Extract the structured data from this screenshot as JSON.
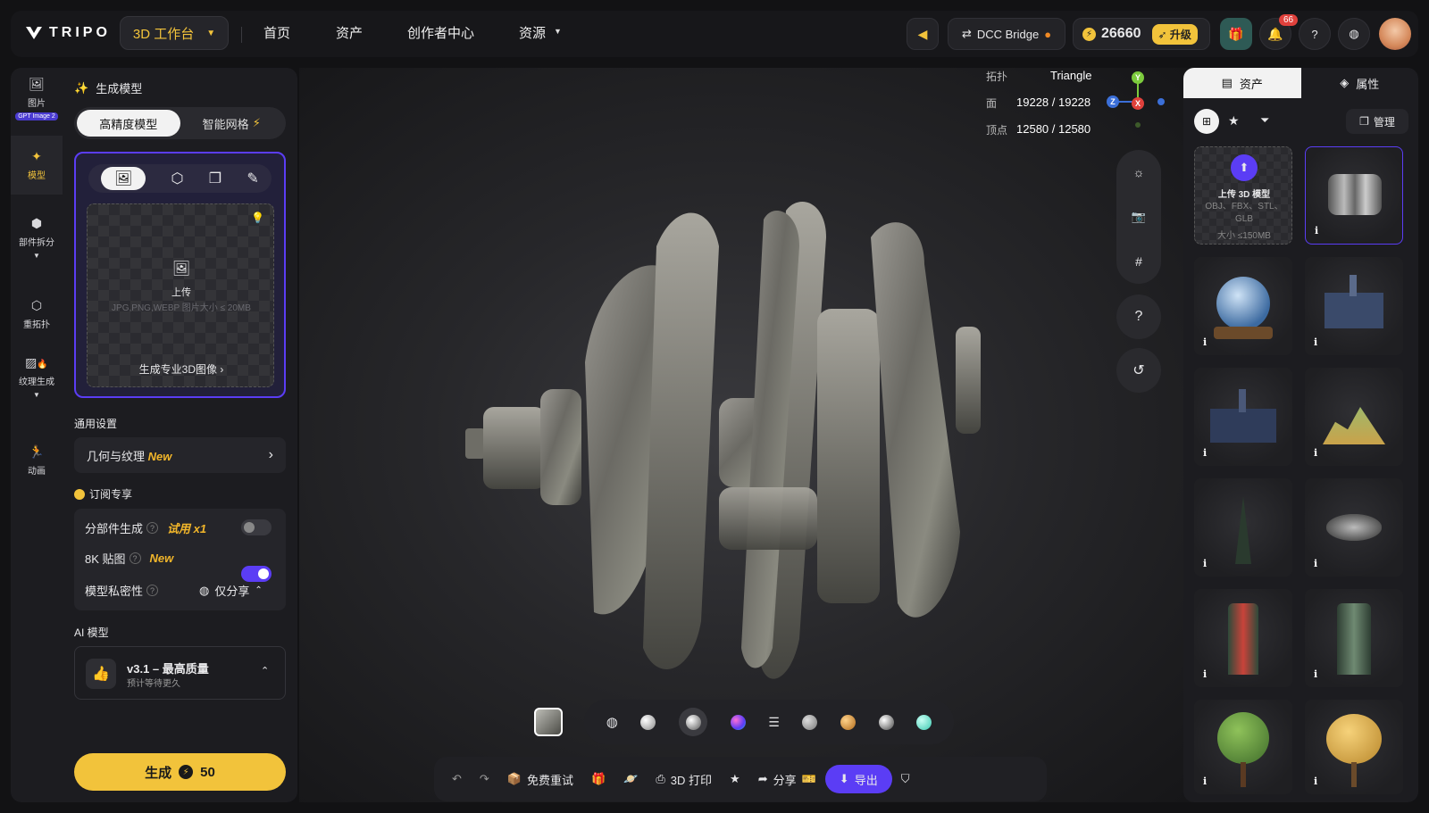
{
  "topbar": {
    "brand": "TRIPO",
    "workspace": "3D 工作台",
    "nav": [
      "首页",
      "资产",
      "创作者中心",
      "资源"
    ],
    "dcc_bridge": "DCC Bridge",
    "credits": "26660",
    "upgrade": "升级",
    "notifications": "66"
  },
  "rail": {
    "image": "图片",
    "gpt_badge": "GPT Image 2",
    "model": "模型",
    "part_split": "部件拆分",
    "retopo": "重拓扑",
    "texture": "纹理生成",
    "animation": "动画"
  },
  "panel": {
    "header": "生成模型",
    "tab_hd": "高精度模型",
    "tab_smart": "智能网格",
    "upload_label": "上传",
    "upload_hint": "JPG,PNG,WEBP 图片大小 ≤ 20MB",
    "pro_image": "生成专业3D图像",
    "general_settings": "通用设置",
    "geo_texture": "几何与纹理",
    "new": "New",
    "subscribe": "订阅专享",
    "part_gen": "分部件生成",
    "trial": "试用 x1",
    "tex8k": "8K 贴图",
    "privacy": "模型私密性",
    "privacy_value": "仅分享",
    "ai_model": "AI 模型",
    "model_name": "v3.1 – 最高质量",
    "model_note": "预计等待更久",
    "generate": "生成",
    "generate_cost": "50"
  },
  "stats": {
    "topo_label": "拓扑",
    "topo_value": "Triangle",
    "faces_label": "面",
    "faces_value": "19228 / 19228",
    "verts_label": "顶点",
    "verts_value": "12580 / 12580"
  },
  "axes": {
    "y": "Y",
    "z": "Z",
    "x": "X"
  },
  "right": {
    "tab_assets": "资产",
    "tab_props": "属性",
    "manage": "管理",
    "upload_title": "上传 3D 模型",
    "upload_formats": "OBJ、FBX、STL、GLB",
    "upload_size": "大小 ≤150MB",
    "info": "i"
  },
  "actions": {
    "retry": "免费重试",
    "print": "3D 打印",
    "share": "分享",
    "export": "导出"
  },
  "colors": {
    "accent": "#f2c33b",
    "purple": "#5b3df5",
    "panel": "#1c1c20"
  }
}
